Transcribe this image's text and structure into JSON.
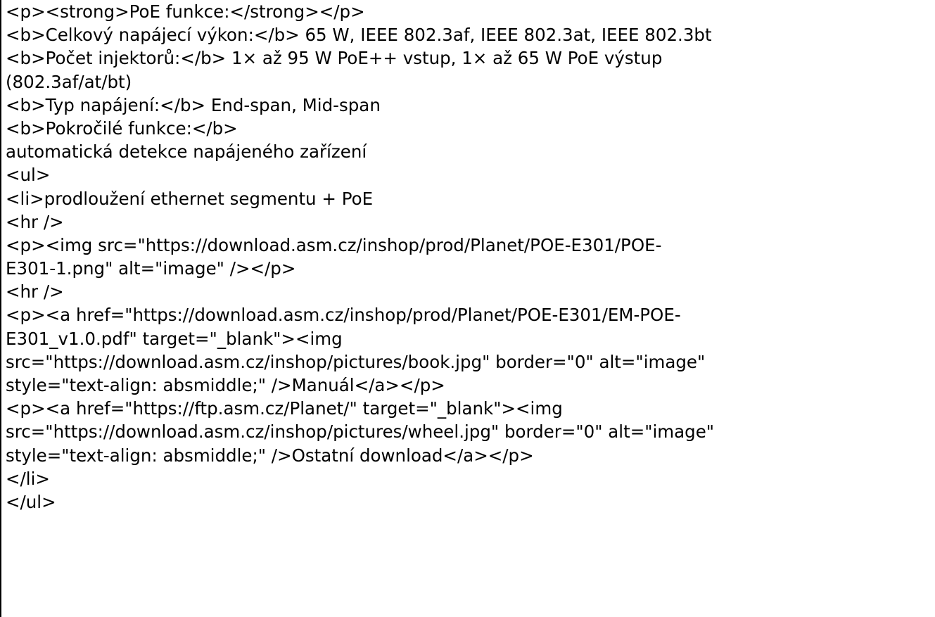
{
  "source_lines": [
    "<p><strong>PoE funkce:</strong></p>",
    "<b>Celkový napájecí výkon:</b> 65 W, IEEE 802.3af, IEEE 802.3at, IEEE 802.3bt",
    "<b>Počet injektorů:</b> 1× až 95 W PoE++ vstup, 1× až 65 W PoE výstup",
    "(802.3af/at/bt)",
    "<b>Typ napájení:</b> End-span, Mid-span",
    "<b>Pokročilé funkce:</b>",
    "automatická detekce napájeného zařízení",
    "<ul>",
    "<li>prodloužení ethernet segmentu + PoE",
    "<hr />",
    "<p><img src=\"https://download.asm.cz/inshop/prod/Planet/POE-E301/POE-",
    "E301-1.png\" alt=\"image\" /></p>",
    "<hr />",
    "<p><a href=\"https://download.asm.cz/inshop/prod/Planet/POE-E301/EM-POE-",
    "E301_v1.0.pdf\" target=\"_blank\"><img",
    "src=\"https://download.asm.cz/inshop/pictures/book.jpg\" border=\"0\" alt=\"image\"",
    "style=\"text-align: absmiddle;\" />Manuál</a></p>",
    "<p><a href=\"https://ftp.asm.cz/Planet/\" target=\"_blank\"><img",
    "src=\"https://download.asm.cz/inshop/pictures/wheel.jpg\" border=\"0\" alt=\"image\"",
    "style=\"text-align: absmiddle;\" />Ostatní download</a></p>",
    "</li>",
    "</ul>"
  ]
}
